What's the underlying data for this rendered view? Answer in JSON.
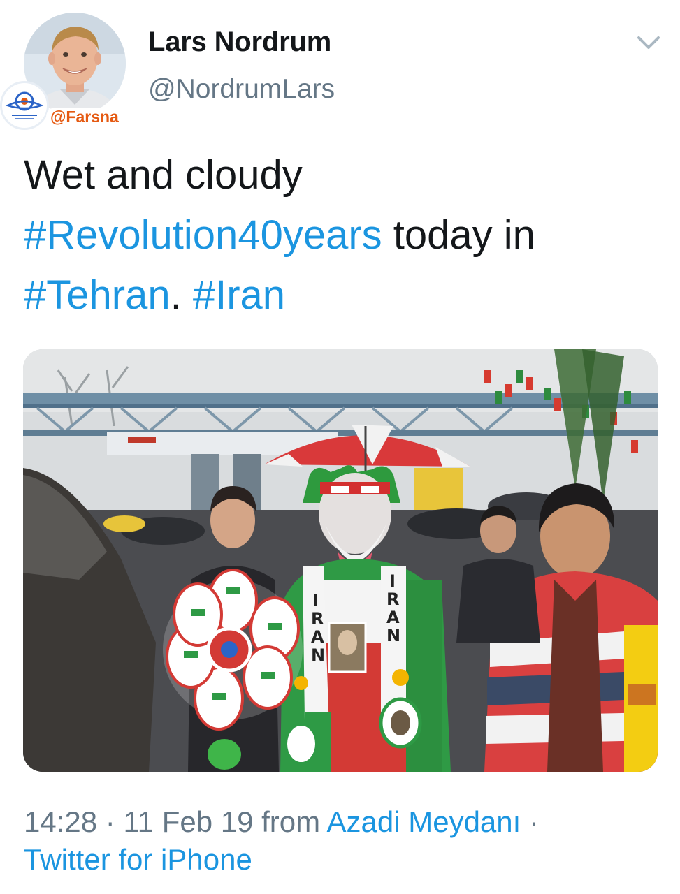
{
  "author": {
    "display_name": "Lars Nordrum",
    "handle": "@NordrumLars"
  },
  "watermark": {
    "handle": "@Farsna"
  },
  "tweet": {
    "line1": "Wet and cloudy",
    "hashtag_revolution": "#Revolution40years",
    "text_today": " today in",
    "hashtag_tehran": "#Tehran",
    "separator": ". ",
    "hashtag_iran": "#Iran"
  },
  "meta": {
    "time": "14:28",
    "dot1": " · ",
    "date": "11 Feb 19",
    "from_label": " from ",
    "location": "Azadi Meydanı",
    "dot2": " ·",
    "source": "Twitter for iPhone"
  },
  "photo": {
    "scarf_text_left": "IRAN",
    "scarf_text_right": "IRAN"
  },
  "colors": {
    "link": "#1b95e0",
    "secondary": "#657786",
    "text": "#14171a",
    "watermark": "#e55a12"
  },
  "icons": {
    "caret": "chevron-down-icon"
  }
}
